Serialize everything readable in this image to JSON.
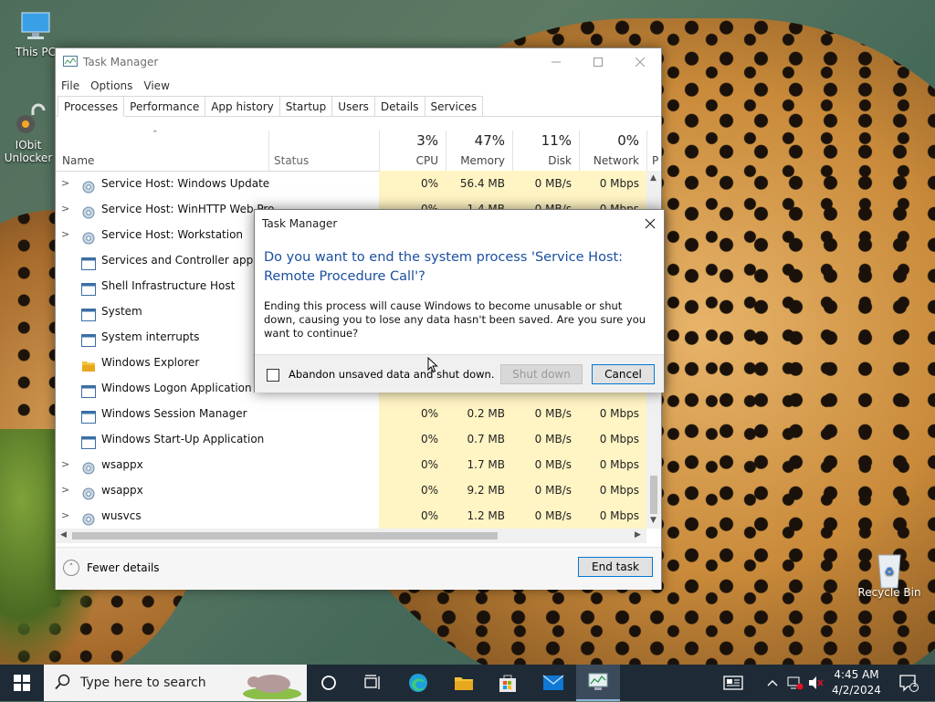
{
  "desktop": {
    "icons": [
      {
        "label": "This PC"
      },
      {
        "label": "IObit Unlocker"
      },
      {
        "label": "Recycle Bin"
      }
    ]
  },
  "task_manager": {
    "title": "Task Manager",
    "menu": [
      "File",
      "Options",
      "View"
    ],
    "tabs": [
      "Processes",
      "Performance",
      "App history",
      "Startup",
      "Users",
      "Details",
      "Services"
    ],
    "active_tab": "Processes",
    "columns": {
      "name": "Name",
      "status": "Status",
      "cpu": {
        "pct": "3%",
        "label": "CPU"
      },
      "memory": {
        "pct": "47%",
        "label": "Memory"
      },
      "disk": {
        "pct": "11%",
        "label": "Disk"
      },
      "network": {
        "pct": "0%",
        "label": "Network"
      },
      "extra": "P"
    },
    "rows": [
      {
        "name": "Service Host: Windows Update",
        "expandable": true,
        "icon": "gear-icon",
        "cpu": "0%",
        "memory": "56.4 MB",
        "disk": "0 MB/s",
        "network": "0 Mbps"
      },
      {
        "name": "Service Host: WinHTTP Web Pro",
        "expandable": true,
        "icon": "gear-icon",
        "cpu": "0%",
        "memory": "1.4 MB",
        "disk": "0 MB/s",
        "network": "0 Mbps"
      },
      {
        "name": "Service Host: Workstation",
        "expandable": true,
        "icon": "gear-icon",
        "cpu": "",
        "memory": "",
        "disk": "",
        "network": ""
      },
      {
        "name": "Services and Controller app",
        "expandable": false,
        "icon": "window-icon",
        "cpu": "",
        "memory": "",
        "disk": "",
        "network": ""
      },
      {
        "name": "Shell Infrastructure Host",
        "expandable": false,
        "icon": "window-icon",
        "cpu": "",
        "memory": "",
        "disk": "",
        "network": ""
      },
      {
        "name": "System",
        "expandable": false,
        "icon": "window-icon",
        "cpu": "",
        "memory": "",
        "disk": "",
        "network": ""
      },
      {
        "name": "System interrupts",
        "expandable": false,
        "icon": "window-icon",
        "cpu": "",
        "memory": "",
        "disk": "",
        "network": ""
      },
      {
        "name": "Windows Explorer",
        "expandable": false,
        "icon": "folder-icon",
        "cpu": "",
        "memory": "",
        "disk": "",
        "network": ""
      },
      {
        "name": "Windows Logon Application",
        "expandable": false,
        "icon": "window-icon",
        "cpu": "",
        "memory": "",
        "disk": "",
        "network": ""
      },
      {
        "name": "Windows Session Manager",
        "expandable": false,
        "icon": "window-icon",
        "cpu": "0%",
        "memory": "0.2 MB",
        "disk": "0 MB/s",
        "network": "0 Mbps"
      },
      {
        "name": "Windows Start-Up Application",
        "expandable": false,
        "icon": "window-icon",
        "cpu": "0%",
        "memory": "0.7 MB",
        "disk": "0 MB/s",
        "network": "0 Mbps"
      },
      {
        "name": "wsappx",
        "expandable": true,
        "icon": "gear-icon",
        "cpu": "0%",
        "memory": "1.7 MB",
        "disk": "0 MB/s",
        "network": "0 Mbps"
      },
      {
        "name": "wsappx",
        "expandable": true,
        "icon": "gear-icon",
        "cpu": "0%",
        "memory": "9.2 MB",
        "disk": "0 MB/s",
        "network": "0 Mbps"
      },
      {
        "name": "wusvcs",
        "expandable": true,
        "icon": "gear-icon",
        "cpu": "0%",
        "memory": "1.2 MB",
        "disk": "0 MB/s",
        "network": "0 Mbps"
      }
    ],
    "footer": {
      "fewer_details": "Fewer details",
      "end_task": "End task"
    }
  },
  "dialog": {
    "title": "Task Manager",
    "main": "Do you want to end the system process 'Service Host: Remote Procedure Call'?",
    "body": "Ending this process will cause Windows to become unusable or shut down, causing you to lose any data hasn't been saved. Are you sure you want to continue?",
    "checkbox_label": "Abandon unsaved data and shut down.",
    "checkbox_checked": false,
    "shutdown_label": "Shut down",
    "cancel_label": "Cancel"
  },
  "taskbar": {
    "search_placeholder": "Type here to search",
    "time": "4:45 AM",
    "date": "4/2/2024",
    "notification_count": "1",
    "accent": "#0078d7"
  }
}
